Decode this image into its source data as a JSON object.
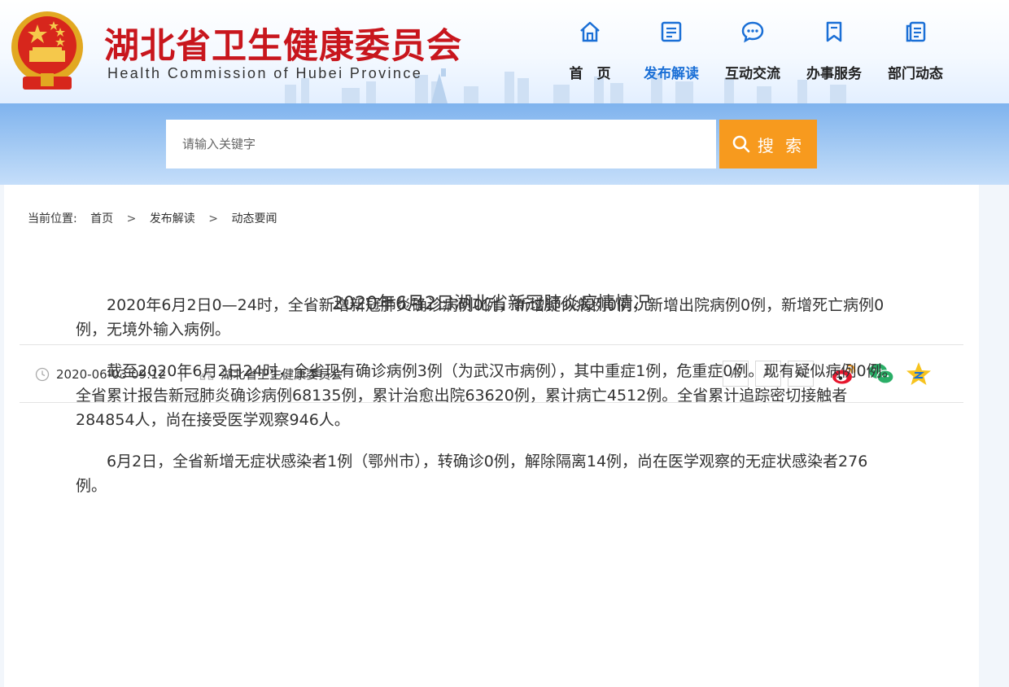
{
  "header": {
    "site_title": "湖北省卫生健康委员会",
    "site_subtitle": "Health Commission of Hubei Province"
  },
  "nav": {
    "items": [
      {
        "label": "首　页",
        "icon": "home-icon",
        "active": false
      },
      {
        "label": "发布解读",
        "icon": "document-icon",
        "active": true
      },
      {
        "label": "互动交流",
        "icon": "chat-icon",
        "active": false
      },
      {
        "label": "办事服务",
        "icon": "bookmark-icon",
        "active": false
      },
      {
        "label": "部门动态",
        "icon": "pages-icon",
        "active": false
      }
    ]
  },
  "search": {
    "placeholder": "请输入关键字",
    "button_label": "搜 索"
  },
  "breadcrumb": {
    "prefix": "当前位置:",
    "items": [
      "首页",
      "发布解读",
      "动态要闻"
    ],
    "separator": ">"
  },
  "article": {
    "title": "2020年6月2日湖北省新冠肺炎疫情情况",
    "datetime": "2020-06-03 09:12",
    "source": "湖北省卫生健康委员会",
    "paragraphs": [
      "2020年6月2日0—24时，全省新增新冠肺炎确诊病例0例，新增疑似病例0例，新增出院病例0例，新增死亡病例0例，无境外输入病例。",
      "截至2020年6月2日24时，全省现有确诊病例3例（为武汉市病例），其中重症1例，危重症0例。现有疑似病例0例。全省累计报告新冠肺炎确诊病例68135例，累计治愈出院63620例，累计病亡4512例。全省累计追踪密切接触者284854人，尚在接受医学观察946人。",
      "6月2日，全省新增无症状感染者1例（鄂州市），转确诊0例，解除隔离14例，尚在医学观察的无症状感染者276例。"
    ]
  },
  "tools": {
    "font_increase": "A",
    "font_decrease": "A",
    "font_reset": "A",
    "increase_mark": "+",
    "decrease_mark": "-"
  },
  "colors": {
    "title_red": "#c8161d",
    "nav_blue": "#1a6fd6",
    "search_orange": "#f79a1e"
  }
}
